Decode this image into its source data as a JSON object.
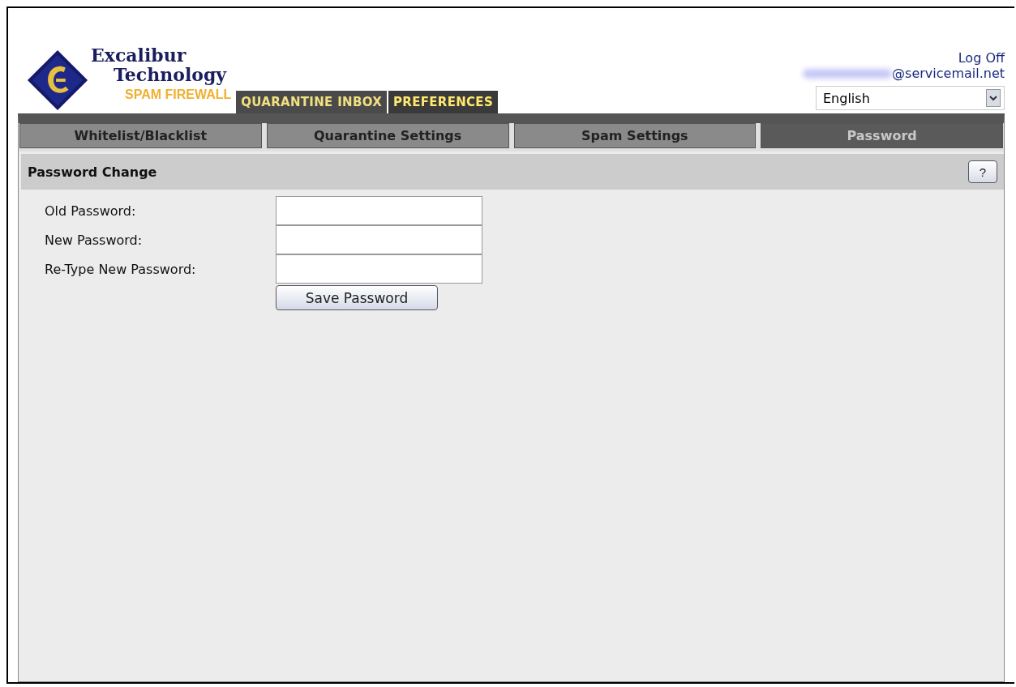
{
  "logo": {
    "name_line_1": "Excalibur",
    "name_line_2": "Technology",
    "product": "SPAM FIREWALL"
  },
  "main_tabs": [
    {
      "label": "QUARANTINE INBOX",
      "selected": false
    },
    {
      "label": "PREFERENCES",
      "selected": true
    }
  ],
  "user": {
    "log_off": "Log Off",
    "email_domain": "@servicemail.net",
    "language": "English"
  },
  "sub_tabs": [
    {
      "label": "Whitelist/Blacklist",
      "selected": false
    },
    {
      "label": "Quarantine Settings",
      "selected": false
    },
    {
      "label": "Spam Settings",
      "selected": false
    },
    {
      "label": "Password",
      "selected": true
    }
  ],
  "section": {
    "title": "Password Change",
    "help": "?"
  },
  "fields": [
    {
      "label": "Old Password:"
    },
    {
      "label": "New Password:"
    },
    {
      "label": "Re-Type New Password:"
    }
  ],
  "save_button": "Save Password"
}
